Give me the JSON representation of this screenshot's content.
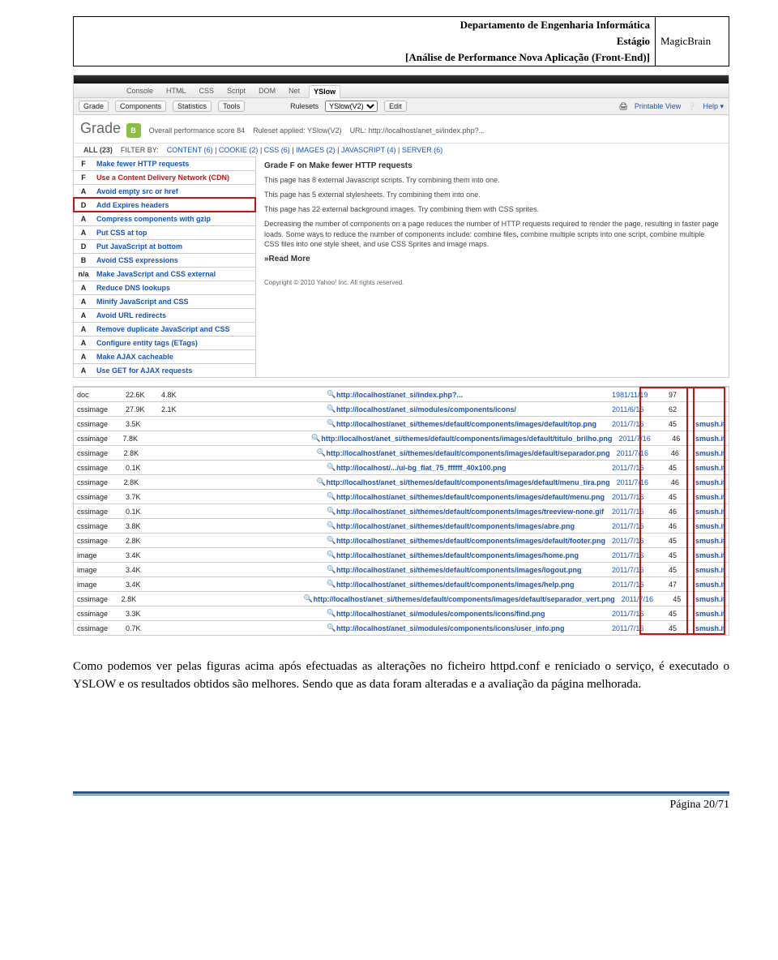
{
  "header": {
    "line1": "Departamento de Engenharia Informática",
    "line2": "Estágio",
    "line3": "[Análise de Performance Nova Aplicação (Front-End)]",
    "right": "MagicBrain"
  },
  "shot1": {
    "tabs": [
      "Console",
      "HTML",
      "CSS",
      "Script",
      "DOM",
      "Net",
      "YSlow"
    ],
    "active_tab": "YSlow",
    "subtabs": [
      "Grade",
      "Components",
      "Statistics",
      "Tools"
    ],
    "ruleset_lbl": "Rulesets",
    "ruleset_val": "YSlow(V2)",
    "edit": "Edit",
    "printable": "Printable View",
    "help": "Help ▾",
    "grade_word": "Grade",
    "grade_letter": "B",
    "score_line_a": "Overall performance score 84",
    "score_line_b": "Ruleset applied: YSlow(V2)",
    "score_line_c": "URL: http://localhost/anet_si/index.php?...",
    "all": "ALL (23)",
    "filter_lbl": "FILTER BY:",
    "filters": [
      "CONTENT (6)",
      "COOKIE (2)",
      "CSS (6)",
      "IMAGES (2)",
      "JAVASCRIPT (4)",
      "SERVER (6)"
    ],
    "rules": [
      {
        "g": "F",
        "t": "Make fewer HTTP requests",
        "hl": false
      },
      {
        "g": "F",
        "t": "Use a Content Delivery Network (CDN)",
        "hl": false,
        "red": true
      },
      {
        "g": "A",
        "t": "Avoid empty src or href",
        "hl": false
      },
      {
        "g": "D",
        "t": "Add Expires headers",
        "hl": true
      },
      {
        "g": "A",
        "t": "Compress components with gzip",
        "hl": false
      },
      {
        "g": "A",
        "t": "Put CSS at top",
        "hl": false
      },
      {
        "g": "D",
        "t": "Put JavaScript at bottom",
        "hl": false
      },
      {
        "g": "B",
        "t": "Avoid CSS expressions",
        "hl": false
      },
      {
        "g": "n/a",
        "t": "Make JavaScript and CSS external",
        "hl": false
      },
      {
        "g": "A",
        "t": "Reduce DNS lookups",
        "hl": false
      },
      {
        "g": "A",
        "t": "Minify JavaScript and CSS",
        "hl": false
      },
      {
        "g": "A",
        "t": "Avoid URL redirects",
        "hl": false
      },
      {
        "g": "A",
        "t": "Remove duplicate JavaScript and CSS",
        "hl": false
      },
      {
        "g": "A",
        "t": "Configure entity tags (ETags)",
        "hl": false
      },
      {
        "g": "A",
        "t": "Make AJAX cacheable",
        "hl": false
      },
      {
        "g": "A",
        "t": "Use GET for AJAX requests",
        "hl": false
      }
    ],
    "detail_title": "Grade F on Make fewer HTTP requests",
    "detail_p1": "This page has 8 external Javascript scripts. Try combining them into one.",
    "detail_p2": "This page has 5 external stylesheets. Try combining them into one.",
    "detail_p3": "This page has 22 external background images. Try combining them with CSS sprites.",
    "detail_p4": "Decreasing the number of components on a page reduces the number of HTTP requests required to render the page, resulting in faster page loads. Some ways to reduce the number of components include: combine files, combine multiple scripts into one script, combine multiple CSS files into one style sheet, and use CSS Sprites and image maps.",
    "readmore": "»Read More",
    "copyright": "Copyright © 2010 Yahoo! Inc. All rights reserved."
  },
  "shot2": {
    "rows": [
      {
        "type": "doc",
        "s1": "22.6K",
        "s2": "4.8K",
        "url": "http://localhost/anet_si/index.php?...",
        "date": "1981/11/19",
        "n": "97",
        "a": ""
      },
      {
        "type": "cssimage",
        "s1": "27.9K",
        "s2": "2.1K",
        "url": "http://localhost/anet_si/modules/components/icons/",
        "date": "2011/6/16",
        "n": "62",
        "a": ""
      },
      {
        "type": "cssimage",
        "s1": "3.5K",
        "s2": "",
        "url": "http://localhost/anet_si/themes/default/components/images/default/top.png",
        "date": "2011/7/16",
        "n": "45",
        "a": "smush.it"
      },
      {
        "type": "cssimage",
        "s1": "7.8K",
        "s2": "",
        "url": "http://localhost/anet_si/themes/default/components/images/default/titulo_brilho.png",
        "date": "2011/7/16",
        "n": "46",
        "a": "smush.it"
      },
      {
        "type": "cssimage",
        "s1": "2.8K",
        "s2": "",
        "url": "http://localhost/anet_si/themes/default/components/images/default/separador.png",
        "date": "2011/7/16",
        "n": "46",
        "a": "smush.it"
      },
      {
        "type": "cssimage",
        "s1": "0.1K",
        "s2": "",
        "url": "http://localhost/.../ui-bg_flat_75_ffffff_40x100.png",
        "date": "2011/7/16",
        "n": "45",
        "a": "smush.it"
      },
      {
        "type": "cssimage",
        "s1": "2.8K",
        "s2": "",
        "url": "http://localhost/anet_si/themes/default/components/images/default/menu_tira.png",
        "date": "2011/7/16",
        "n": "46",
        "a": "smush.it"
      },
      {
        "type": "cssimage",
        "s1": "3.7K",
        "s2": "",
        "url": "http://localhost/anet_si/themes/default/components/images/default/menu.png",
        "date": "2011/7/16",
        "n": "45",
        "a": "smush.it"
      },
      {
        "type": "cssimage",
        "s1": "0.1K",
        "s2": "",
        "url": "http://localhost/anet_si/themes/default/components/images/treeview-none.gif",
        "date": "2011/7/16",
        "n": "46",
        "a": "smush.it"
      },
      {
        "type": "cssimage",
        "s1": "3.8K",
        "s2": "",
        "url": "http://localhost/anet_si/themes/default/components/images/abre.png",
        "date": "2011/7/16",
        "n": "46",
        "a": "smush.it"
      },
      {
        "type": "cssimage",
        "s1": "2.8K",
        "s2": "",
        "url": "http://localhost/anet_si/themes/default/components/images/default/footer.png",
        "date": "2011/7/16",
        "n": "45",
        "a": "smush.it"
      },
      {
        "type": "image",
        "s1": "3.4K",
        "s2": "",
        "url": "http://localhost/anet_si/themes/default/components/images/home.png",
        "date": "2011/7/16",
        "n": "45",
        "a": "smush.it"
      },
      {
        "type": "image",
        "s1": "3.4K",
        "s2": "",
        "url": "http://localhost/anet_si/themes/default/components/images/logout.png",
        "date": "2011/7/16",
        "n": "45",
        "a": "smush.it"
      },
      {
        "type": "image",
        "s1": "3.4K",
        "s2": "",
        "url": "http://localhost/anet_si/themes/default/components/images/help.png",
        "date": "2011/7/16",
        "n": "47",
        "a": "smush.it"
      },
      {
        "type": "cssimage",
        "s1": "2.8K",
        "s2": "",
        "url": "http://localhost/anet_si/themes/default/components/images/default/separador_vert.png",
        "date": "2011/7/16",
        "n": "45",
        "a": "smush.it"
      },
      {
        "type": "cssimage",
        "s1": "3.3K",
        "s2": "",
        "url": "http://localhost/anet_si/modules/components/icons/find.png",
        "date": "2011/7/16",
        "n": "45",
        "a": "smush.it"
      },
      {
        "type": "cssimage",
        "s1": "0.7K",
        "s2": "",
        "url": "http://localhost/anet_si/modules/components/icons/user_info.png",
        "date": "2011/7/16",
        "n": "45",
        "a": "smush.it"
      }
    ]
  },
  "paragraph": "Como podemos ver pelas figuras acima após efectuadas as alterações no ficheiro httpd.conf e reniciado o serviço, é executado o YSLOW e os resultados obtidos são melhores. Sendo que as data foram alteradas e a avaliação da página melhorada.",
  "footer": "Página 20/71"
}
